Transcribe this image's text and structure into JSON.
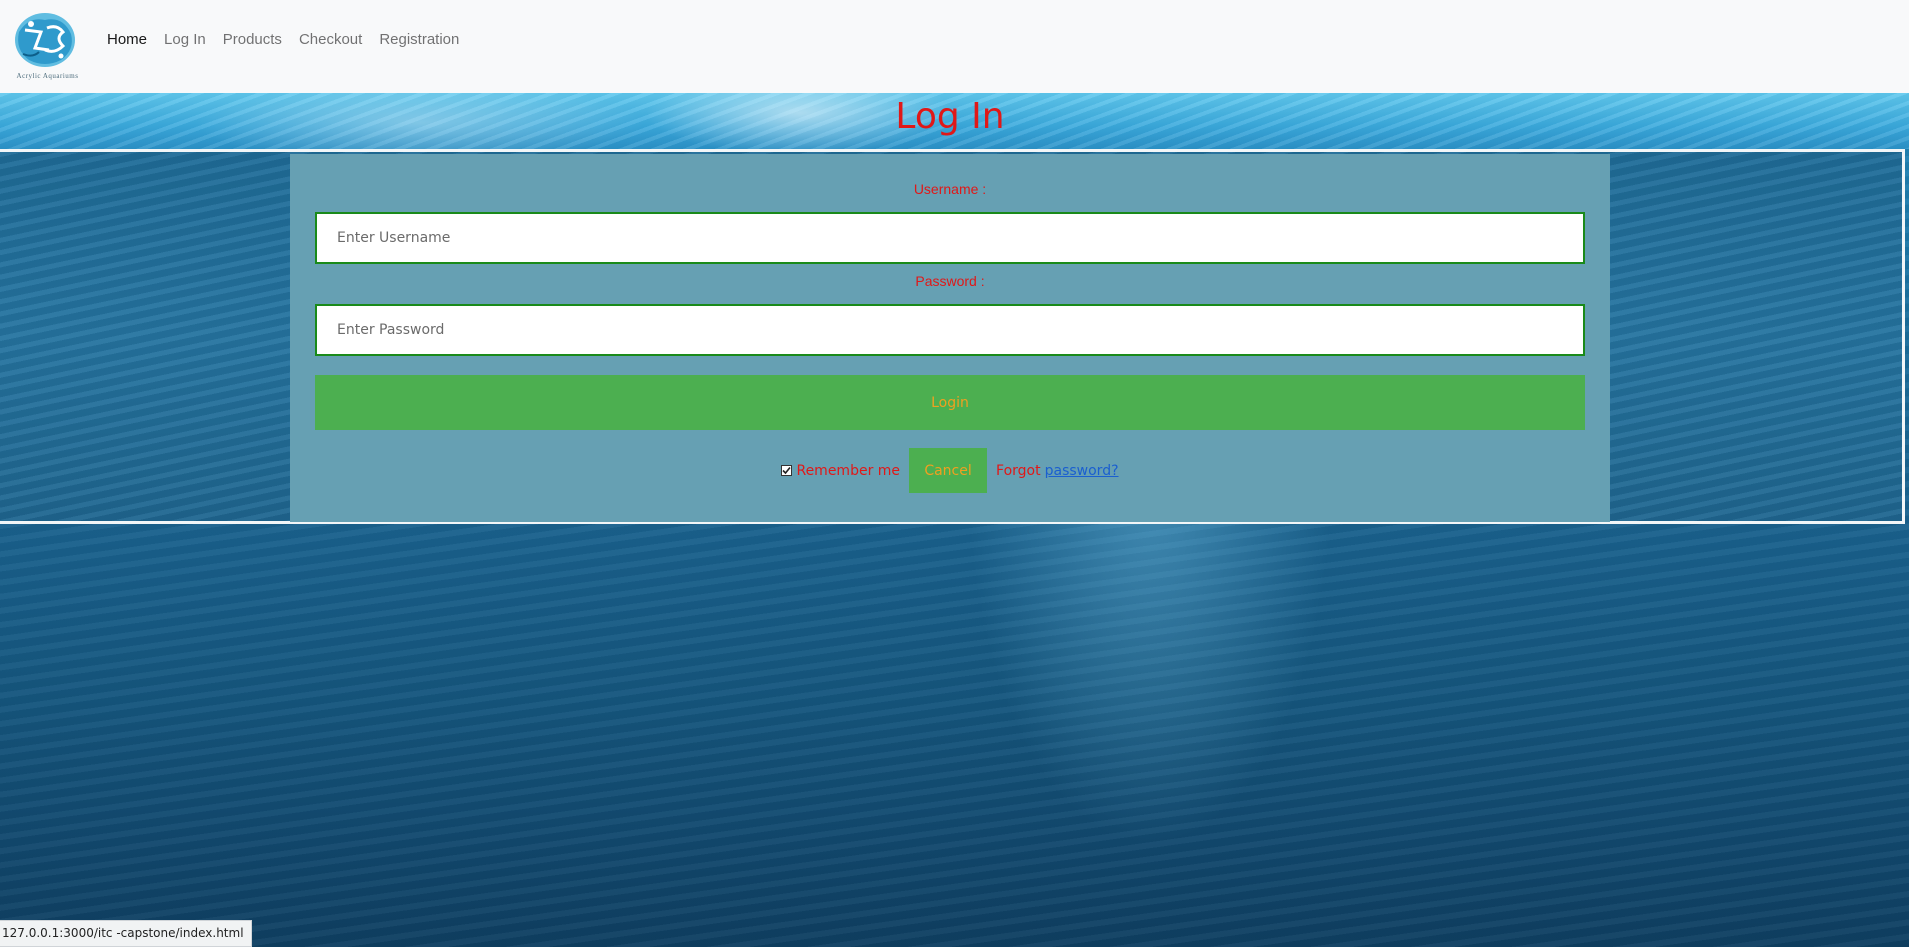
{
  "brand": {
    "logo_text": "Acrylic Aquariums"
  },
  "nav": {
    "items": [
      {
        "label": "Home",
        "active": true
      },
      {
        "label": "Log In",
        "active": false
      },
      {
        "label": "Products",
        "active": false
      },
      {
        "label": "Checkout",
        "active": false
      },
      {
        "label": "Registration",
        "active": false
      }
    ]
  },
  "page": {
    "title": "Log In"
  },
  "form": {
    "username_label": "Username :",
    "username_placeholder": "Enter Username",
    "username_value": "",
    "password_label": "Password :",
    "password_placeholder": "Enter Password",
    "password_value": "",
    "login_label": "Login",
    "remember_label": "Remember me",
    "remember_checked": true,
    "cancel_label": "Cancel",
    "forgot_text": "Forgot",
    "forgot_link": "password?"
  },
  "status_bar": {
    "url": "127.0.0.1:3000/itc -capstone/index.html"
  },
  "colors": {
    "accent_red": "#e01818",
    "button_green": "#4caf50",
    "button_text": "#f0a020",
    "panel": "#66a0b3",
    "link": "#1a5fd0"
  }
}
